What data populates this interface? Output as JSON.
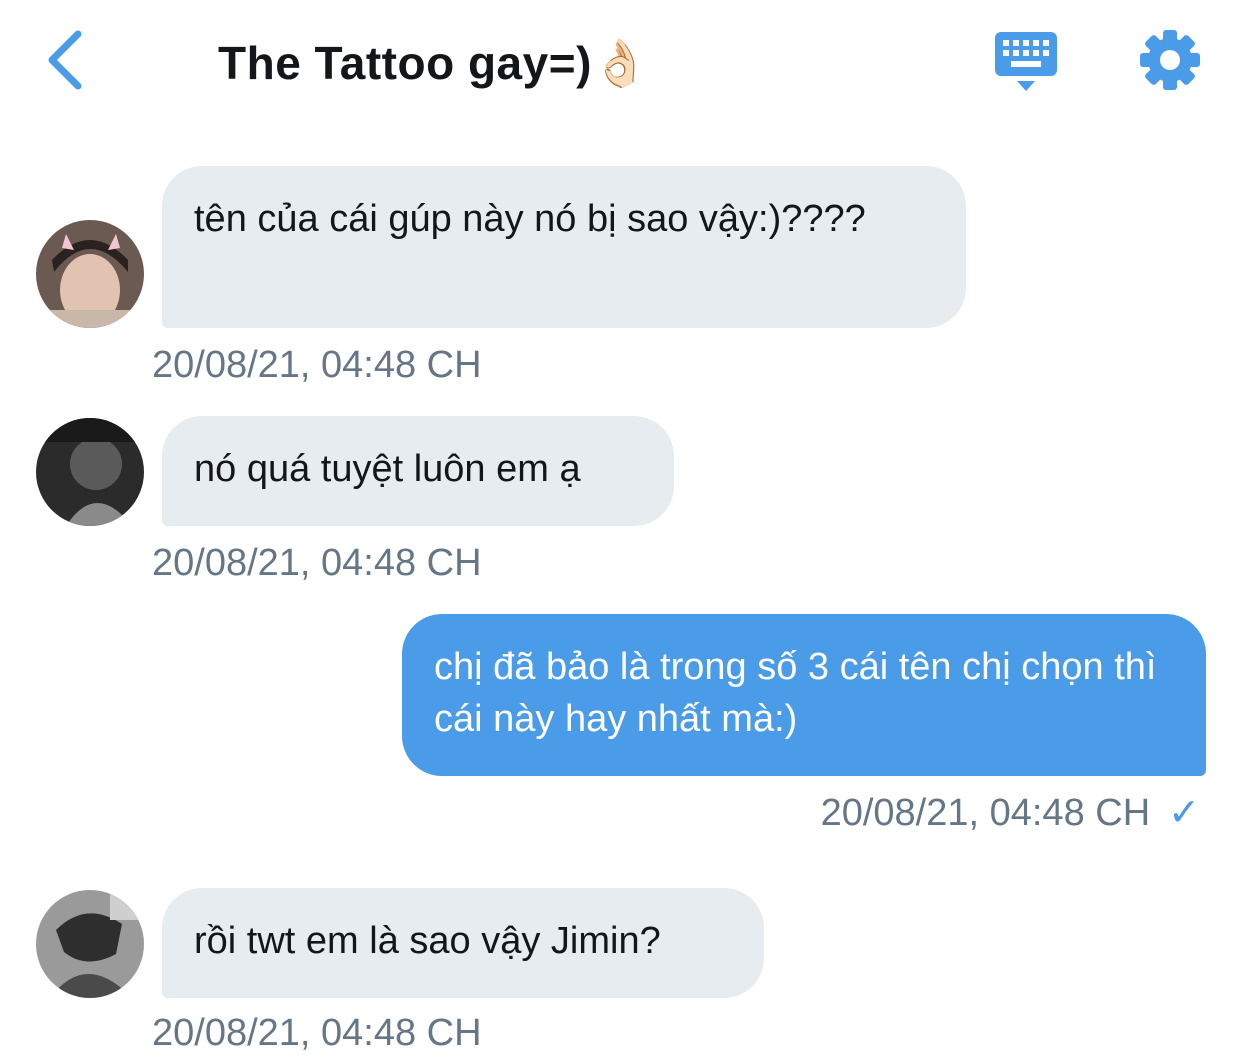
{
  "header": {
    "title": "The Tattoo gay=)👌🏻",
    "icons": {
      "back": "chevron-left-icon",
      "keyboard": "keyboard-icon",
      "settings": "gear-icon"
    },
    "accent": "#4a9be8"
  },
  "messages": [
    {
      "direction": "incoming",
      "text": "tên của cái gúp này nó bị sao vậy:)????",
      "time": "20/08/21, 04:48 CH"
    },
    {
      "direction": "incoming",
      "text": "nó quá tuyệt luôn em ạ",
      "time": "20/08/21, 04:48 CH"
    },
    {
      "direction": "outgoing",
      "text": "chị đã bảo là trong số 3 cái tên chị chọn thì cái này hay nhất mà:)",
      "time": "20/08/21, 04:48 CH",
      "status": "✓"
    },
    {
      "direction": "incoming",
      "text": "rồi twt em là sao vậy Jimin?",
      "time": "20/08/21, 04:48 CH"
    }
  ],
  "colors": {
    "incoming_bubble": "#e6ecf0",
    "outgoing_bubble": "#4a9be8",
    "timestamp": "#657786",
    "text": "#14171a"
  }
}
